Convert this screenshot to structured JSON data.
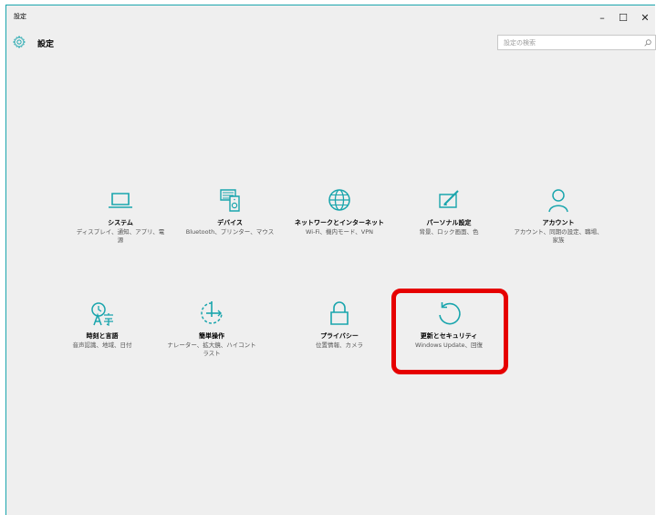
{
  "window": {
    "title": "設定",
    "controls": {
      "minimize": "–",
      "maximize": "☐",
      "close": "✕"
    }
  },
  "header": {
    "title": "設定",
    "search_placeholder": "設定の検索"
  },
  "tiles": [
    {
      "id": "system",
      "name": "システム",
      "desc": "ディスプレイ、通知、アプリ、電源",
      "icon": "laptop-icon"
    },
    {
      "id": "devices",
      "name": "デバイス",
      "desc": "Bluetooth、プリンター、マウス",
      "icon": "devices-icon"
    },
    {
      "id": "network",
      "name": "ネットワークとインターネット",
      "desc": "Wi-Fi、機内モード、VPN",
      "icon": "globe-icon"
    },
    {
      "id": "personalization",
      "name": "パーソナル設定",
      "desc": "背景、ロック画面、色",
      "icon": "personalization-icon"
    },
    {
      "id": "accounts",
      "name": "アカウント",
      "desc": "アカウント、同期の設定、職場、家族",
      "icon": "person-icon"
    },
    {
      "id": "time-language",
      "name": "時刻と言語",
      "desc": "音声認識、地域、日付",
      "icon": "time-language-icon"
    },
    {
      "id": "ease-of-access",
      "name": "簡単操作",
      "desc": "ナレーター、拡大鏡、ハイコントラスト",
      "icon": "ease-of-access-icon"
    },
    {
      "id": "privacy",
      "name": "プライバシー",
      "desc": "位置情報、カメラ",
      "icon": "lock-icon"
    },
    {
      "id": "update-security",
      "name": "更新とセキュリティ",
      "desc": "Windows Update、回復",
      "icon": "refresh-icon"
    }
  ],
  "colors": {
    "accent": "#1aa5ad",
    "highlight": "#e60000"
  }
}
